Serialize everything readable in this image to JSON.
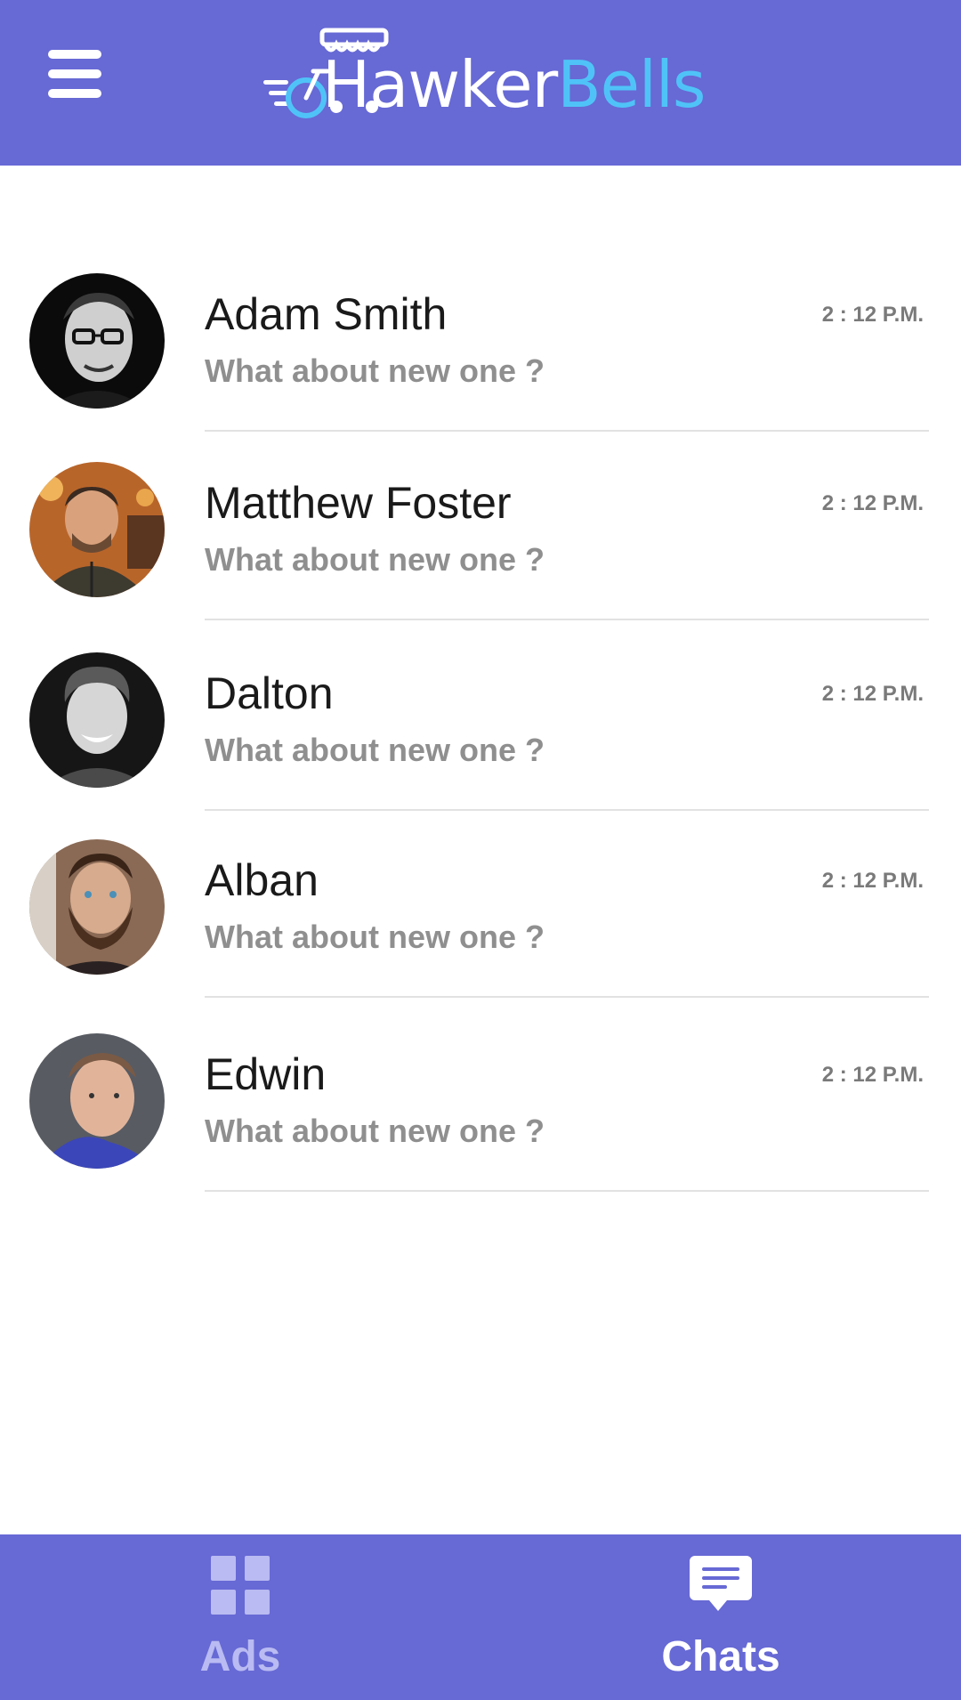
{
  "header": {
    "logo_part1": "Hawker",
    "logo_part2": "Bells",
    "menu_icon": "hamburger-menu-icon"
  },
  "chats": [
    {
      "name": "Adam Smith",
      "preview": "What about new one ?",
      "time": "2 : 12 P.M."
    },
    {
      "name": "Matthew Foster",
      "preview": "What about new one ?",
      "time": "2 : 12 P.M."
    },
    {
      "name": "Dalton",
      "preview": "What about new one ?",
      "time": "2 : 12 P.M."
    },
    {
      "name": "Alban",
      "preview": "What about new one ?",
      "time": "2 : 12 P.M."
    },
    {
      "name": "Edwin",
      "preview": "What about new one ?",
      "time": "2 : 12 P.M."
    }
  ],
  "bottom_nav": {
    "ads_label": "Ads",
    "ads_icon": "grid-icon",
    "chats_label": "Chats",
    "chats_icon": "chat-bubble-icon",
    "active": "Chats"
  },
  "colors": {
    "primary": "#6769d5",
    "logo_accent": "#4fc3f7",
    "inactive_nav": "#b9bbf2",
    "preview_text": "#8f8f8f"
  }
}
